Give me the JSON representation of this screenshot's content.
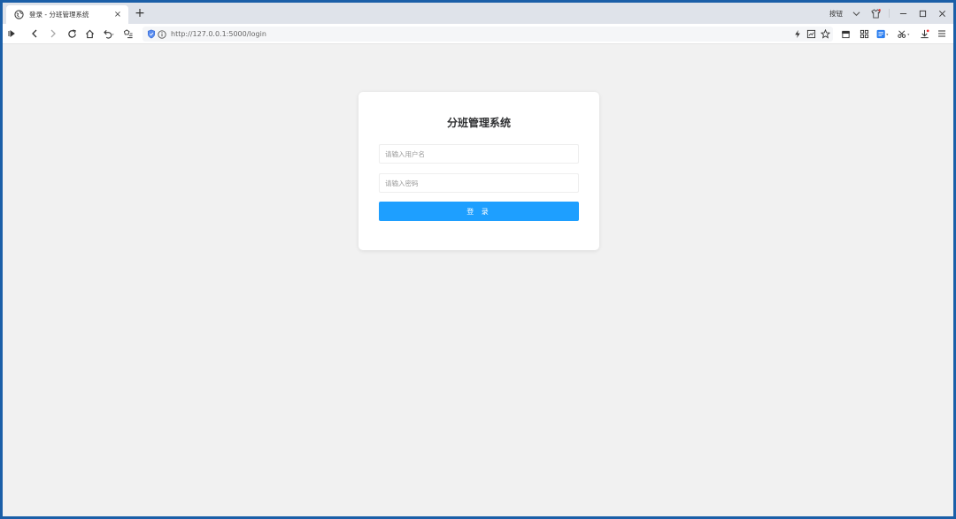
{
  "browser": {
    "tab_title": "登录 - 分班管理系统",
    "tab_close": "×",
    "new_tab": "+",
    "window_label": "按钮",
    "url": "http://127.0.0.1:5000/login"
  },
  "login": {
    "title": "分班管理系统",
    "username_placeholder": "请输入用户名",
    "password_placeholder": "请输入密码",
    "submit_label": "登 录"
  },
  "colors": {
    "accent": "#1e9fff",
    "background": "#f1f1f1",
    "frame": "#1b5fa8"
  }
}
